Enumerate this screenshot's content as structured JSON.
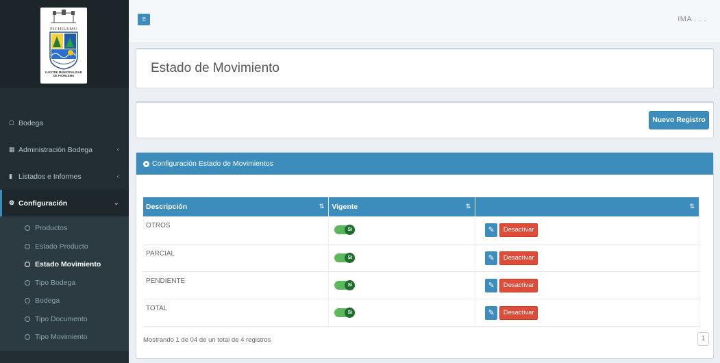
{
  "logo": {
    "crest_title": "PICHILEMU",
    "caption_line1": "ILUSTRE MUNICIPALIDAD",
    "caption_line2": "DE PICHILEMU"
  },
  "sidebar": {
    "items": [
      {
        "label": "Bodega",
        "icon": "home-icon"
      },
      {
        "label": "Administración Bodega",
        "icon": "table-icon"
      },
      {
        "label": "Listados e Informes",
        "icon": "file-icon"
      },
      {
        "label": "Configuración",
        "icon": "cogs-icon"
      }
    ],
    "submenu": [
      "Productos",
      "Estado Producto",
      "Estado Movimiento",
      "Tipo Bodega",
      "Bodega",
      "Tipo Documento",
      "Tipo Movimiento"
    ]
  },
  "header": {
    "toggle_symbol": "≡",
    "user": "IMA . . ."
  },
  "page": {
    "title": "Estado de Movimiento",
    "new_button": "Nuevo Registro"
  },
  "panel": {
    "title": "Configuración Estado de Movimientos",
    "columns": [
      "Descripción",
      "Vigente",
      ""
    ],
    "rows": [
      {
        "descripcion": "OTROS",
        "vigente": "Si",
        "action": "Desactivar"
      },
      {
        "descripcion": "PARCIAL",
        "vigente": "Si",
        "action": "Desactivar"
      },
      {
        "descripcion": "PENDIENTE",
        "vigente": "Si",
        "action": "Desactivar"
      },
      {
        "descripcion": "TOTAL",
        "vigente": "Si",
        "action": "Desactivar"
      }
    ],
    "info": "Mostrando 1 de 04 de un total de 4 registros",
    "page": "1"
  },
  "colors": {
    "primary": "#3c8dbc",
    "danger": "#dd4b39",
    "success": "#5cb85c",
    "sidebar": "#222d32"
  }
}
